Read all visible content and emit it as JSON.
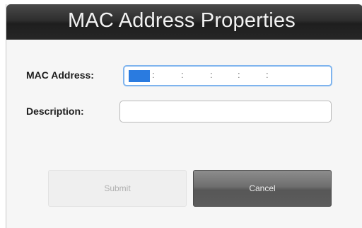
{
  "dialog": {
    "title": "MAC Address Properties"
  },
  "form": {
    "mac_label": "MAC Address:",
    "mac_separators": [
      ":",
      ":",
      ":",
      ":",
      ":"
    ],
    "description_label": "Description:",
    "description_value": ""
  },
  "buttons": {
    "submit_label": "Submit",
    "cancel_label": "Cancel"
  },
  "colors": {
    "title_bar": "#2e2e2e",
    "focus_border": "#7fb4ee",
    "caret_highlight": "#2a7be0"
  }
}
